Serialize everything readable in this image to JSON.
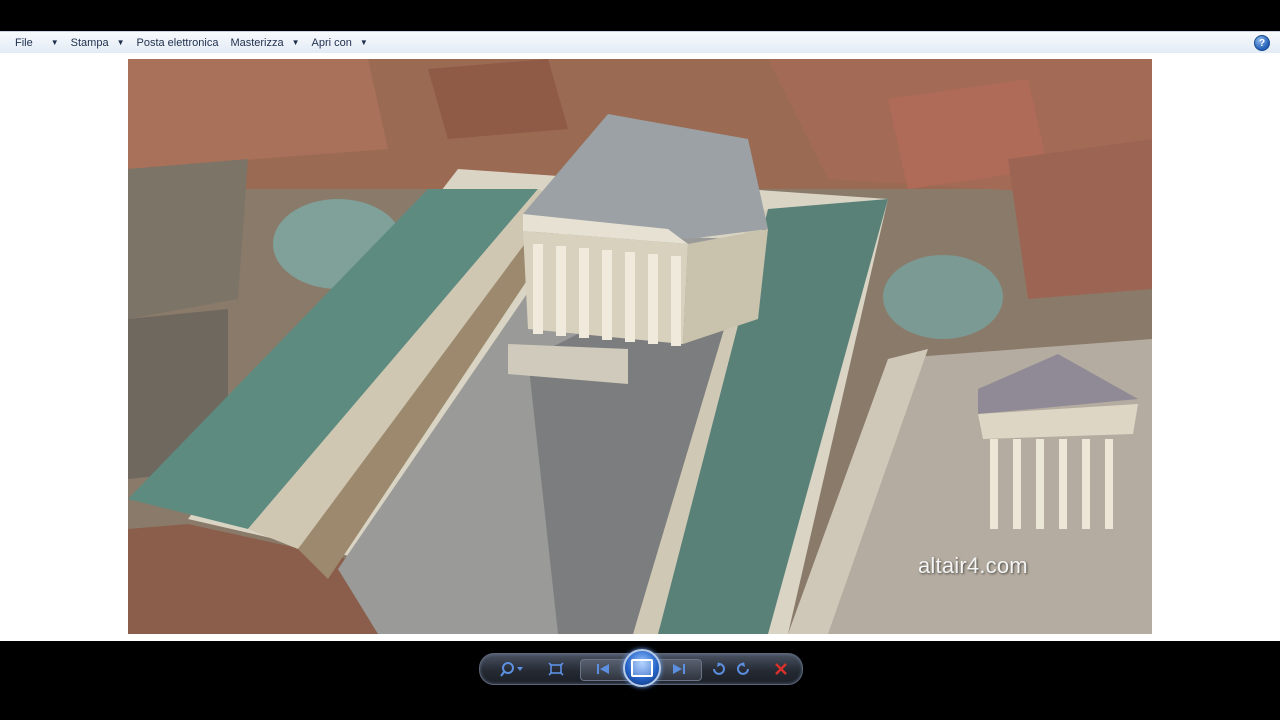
{
  "menubar": {
    "items": [
      {
        "label": "File",
        "has_dropdown": true
      },
      {
        "label": "Stampa",
        "has_dropdown": true
      },
      {
        "label": "Posta elettronica",
        "has_dropdown": false
      },
      {
        "label": "Masterizza",
        "has_dropdown": true
      },
      {
        "label": "Apri con",
        "has_dropdown": true
      }
    ],
    "help_label": "?"
  },
  "image": {
    "watermark": "altair4.com",
    "description_icon": "roman-temple-forum-image"
  },
  "controls": {
    "buttons": [
      "zoom-icon",
      "fit-window-icon",
      "previous-icon",
      "slideshow-icon",
      "next-icon",
      "rotate-left-icon",
      "rotate-right-icon",
      "delete-icon"
    ]
  },
  "colors": {
    "accent": "#3f7fe6",
    "menubar_bg": "#e3ebf5",
    "delete": "#d9322b"
  }
}
